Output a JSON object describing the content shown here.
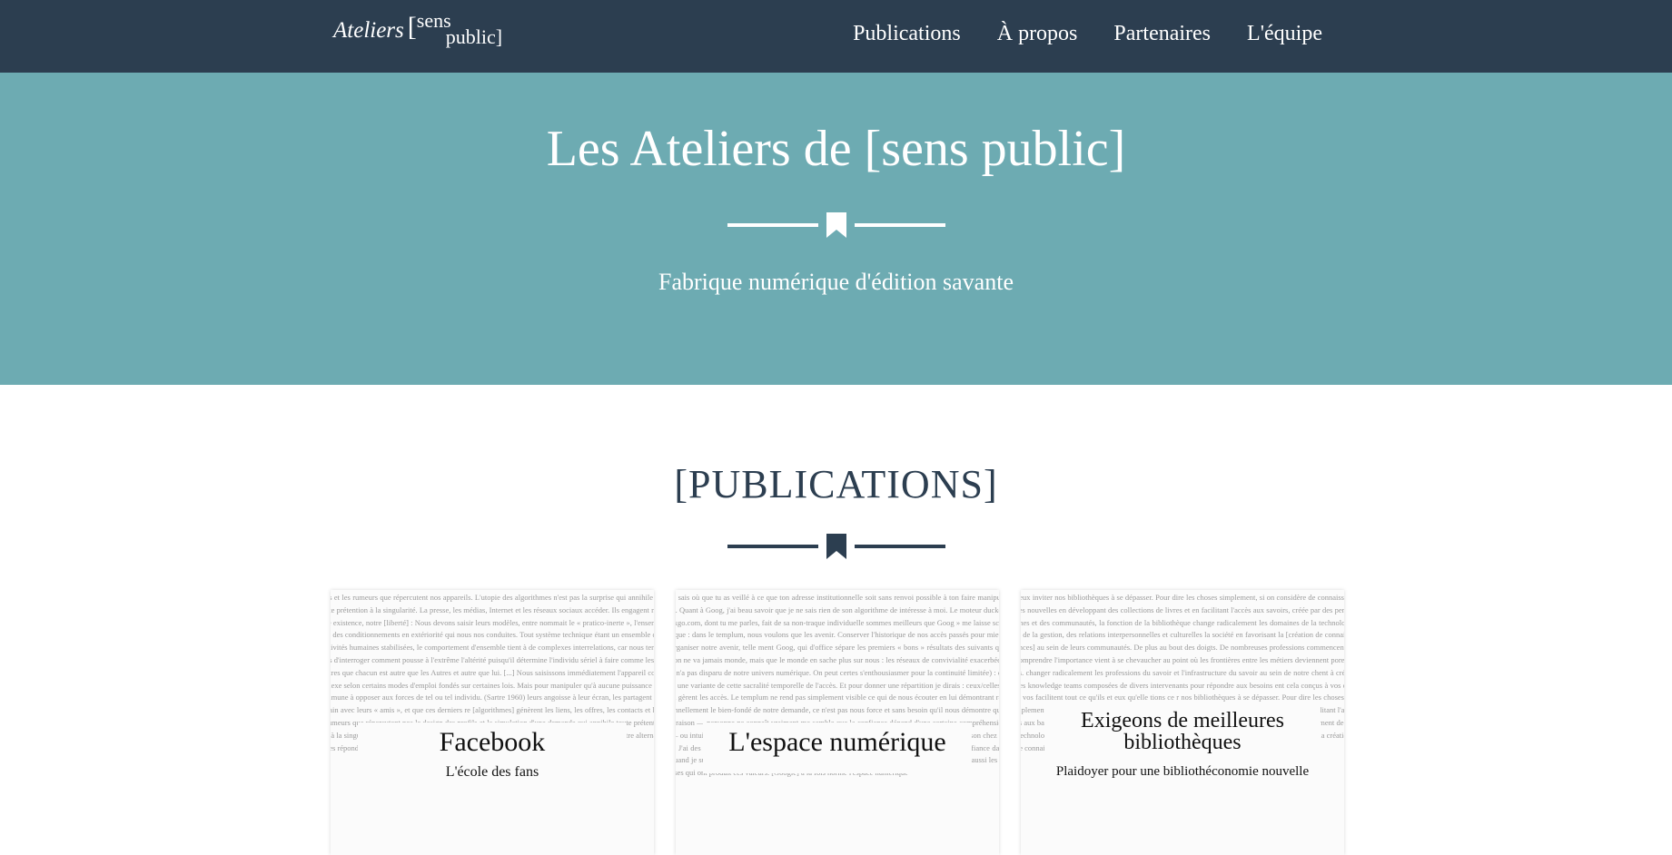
{
  "navbar": {
    "brand": {
      "italic": "Ateliers",
      "top": "sens",
      "bottom": "public",
      "open_bracket": "[",
      "close_bracket": "]"
    },
    "links": [
      "Publications",
      "À propos",
      "Partenaires",
      "L'équipe"
    ]
  },
  "hero": {
    "title": "Les Ateliers de [sens public]",
    "subtitle": "Fabrique numérique d'édition savante",
    "color": "#6dabb2"
  },
  "publications": {
    "title": "[PUBLICATIONS]",
    "cards": [
      {
        "title": "Facebook",
        "subtitle": "L'école des fans",
        "bg_text": "ns et les rumeurs que répercutent nos appareils. L'utopie des algorithmes n'est pas la surprise qui annihile toute prétention à la singularité. La presse, les médias, Internet et les réseaux sociaux accéder. Ils engagent notre existence, notre [liberté] : Nous devons saisir leurs modèles, entre nommait le « pratico-inerte », l'ensemble des conditionnements en extériorité qui nous nos conduites. Tout système technique étant un ensemble d'activités humaines stabilisées, le comportement d'ensemble tient à de complexes interrelations, car nous tentons d'interroger comment pousse à l'extrême l'altérité puisqu'il détermine l'individu sériel à faire comme les Autres que chacun est autre que les Autres et autre que lui. [...] Nous saisissons immédiatement l'appareil complexe selon certains modes d'emploi fondés sur certaines lois. Mais pour manipuler qu'à aucune puissance commune à opposer aux forces de tel ou tel individu. (Sartre 1960) leurs angoisse à leur écran, les partagent en vain avec leurs « amis », et que ces derniers re [algorithmes] génèrent les liens, les offres, les contacts et les rumeurs que répercutent nos le design des profils et la simulation d'une demande qui annihile toute prétention à la singularité possibles, y compris les savoirs auxquels nous pouvons accéder. Ils engagent notre alternatives répondant à nos envies. C'est ce que Sartre nommait le « pratico-inerte »"
      },
      {
        "title": "L'espace numérique",
        "subtitle": "",
        "bg_text": "je sais où que tu as veillé à ce que ton adresse institutionnelle soit sans renvoi possible à ton faire manipuler). Quant à Goog, j'ai beau savoir que je ne sais rien de son algorithme de intéresse à moi. Le moteur duckduckgo.com, dont tu me parles, fait de sa non-traque individuelle sommes meilleurs que Goog » me laisse sceptique : dans le templum, nous voulons que les avenir. Conserver l'historique de nos accès passés pour mieux organiser notre avenir, telle ment Goog, qui d'office sépare les premiers « bons » résultats des suivants que l'on ne va jamais monde, mais que le monde en sache plus sur nous : les réseaux de convivialité exacerbée en n'a pas disparu de notre univers numérique. On peut certes s'enthousiasmer pour la continuité limitée) : c'est une variante de cette sacralité temporelle de l'accès. Et pour donner une répartition je dirais : ceux/celles qui gèrent les accès. Le templum ne rend pas simplement visible ce qui de nous écouter en lui démontrant rationnellement le bien-fondé de notre demande, ce n'est pas nous force et sans besoin qu'il nous démontre qu'il a raison — personne ne connaît vraiment me semble que la confiance dépend d'une certaine compréhension — ou intuition — de l'évasion, que son maître a raison à l'école, et que ses grands parents ont raison chez eux. J'ai des principes différents, principes que, par ailleurs, je peux ne pas bien connaître. J'ai confiance dans quand je suis sur le web, j'ai confiance dans les résultats de Google. Ces résultats sont les plus et aussi les causes qui ont produit ces valeurs. [Google] à la fois norme l'espace numérique"
      },
      {
        "title": "Exigeons de meilleures bibliothèques",
        "subtitle": "Plaidoyer pour une bibliothéconomie nouvelle",
        "bg_text": "veux inviter nos bibliothèques à se dépasser. Pour dire les choses simplement, si on considère de connaissances nouvelles en développant des collections de livres et en facilitant l'accès aux savoirs, créée par des personnes et des communautés, la fonction de la bibliothèque change radicalement les domaines de la technologie, de la gestion, des relations interpersonnelles et culturelles la société en favorisant la [création de connaissances] au sein de leurs communautés. De plus au bout des doigts. De nombreuses professions commencent à comprendre l'importance vient à se chevaucher au point où les frontières entre les métiers deviennent poreuses. changer radicalement les professions du savoir et l'infrastructure du savoir au sein de notre chent à créer des knowledge teams composées de divers intervenants pour répondre aux besoins ent cela conçus à vos es, si vos facilitent tout ce qu'ils et eux qu'elle tions ce r nos bibliothèques à se dépasser. Pour dire les choses simplement, si on considère que la nces nouvelles en développant des collections de livres et en facilitant l'accès aux bases de des personnes et des communautés, la fonction de la bibliothèque change radicalement de la [technologie], de la gestion, des relations interpersonnelles et culturelles, ainsi qu'en en favorisant la création de connaissances au sein de leurs communautés. De plus en plus"
      }
    ]
  },
  "colors": {
    "navbar": "#2c3e50",
    "accent_dark": "#2c3e50",
    "white": "#ffffff"
  }
}
